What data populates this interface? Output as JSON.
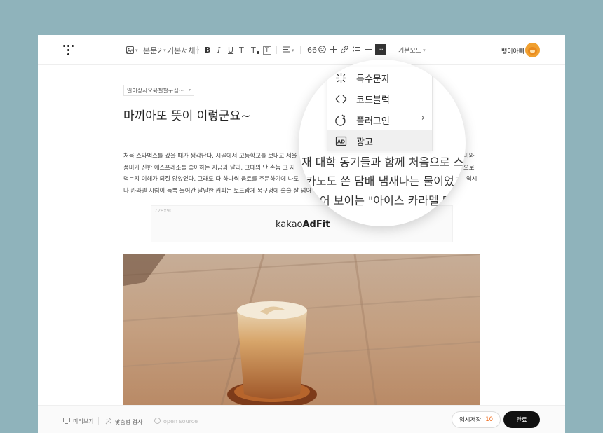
{
  "toolbar": {
    "image_btn": "",
    "paragraph": "본문2",
    "font": "기본서체",
    "bold": "B",
    "italic": "I",
    "underline": "U",
    "strike": "T",
    "color": "T",
    "bg": "T",
    "quote": "66",
    "more": "···",
    "mode": "기본모드"
  },
  "user": {
    "name": "뱅이아빠"
  },
  "post": {
    "category": "일이상사오육칠팔구십···",
    "title": "마끼아또 뜻이 이렇군요~",
    "paragraphs": [
      "처음 스타벅스를 갔을 때가 생각난다. 시골에서 고등학교를 보내고 서울",
      "풍미가 진한 에스프레소를 좋아하는 지금과 달리, 그때의 난 촌놈 그 자",
      "먹는지 이해가 되질 않았었다. 그래도 다 하나씩 음료를 주문하기에 나도",
      "나 카라멜 시럽이 듬뿍 들어간 달달한 커피는 보드랍게 목구멍에 술술 잘 넘어"
    ],
    "paragraph_tails": [
      "미와",
      "으로",
      "역시",
      ""
    ]
  },
  "ad": {
    "size": "728x90",
    "brand_light": "kakao",
    "brand_bold": "AdFit"
  },
  "bottombar": {
    "preview": "미리보기",
    "spellcheck": "맞춤법 검사",
    "opensource": "open source",
    "save": "임시저장",
    "save_count": "10",
    "done": "완료"
  },
  "menu": {
    "items": [
      {
        "label": "특수문자",
        "icon": "special-char-icon"
      },
      {
        "label": "코드블럭",
        "icon": "code-block-icon"
      },
      {
        "label": "플러그인",
        "icon": "plugin-icon",
        "has_submenu": true
      },
      {
        "label": "광고",
        "icon": "ad-icon",
        "active": true
      }
    ]
  },
  "zoom": {
    "lines": [
      "재 대학 동기들과 함께 처음으로 스타벅",
      "카노도 쓴 담배 냄새나는 물이었고,",
      "어 보이는 \"아이스 카라멜 마"
    ]
  }
}
